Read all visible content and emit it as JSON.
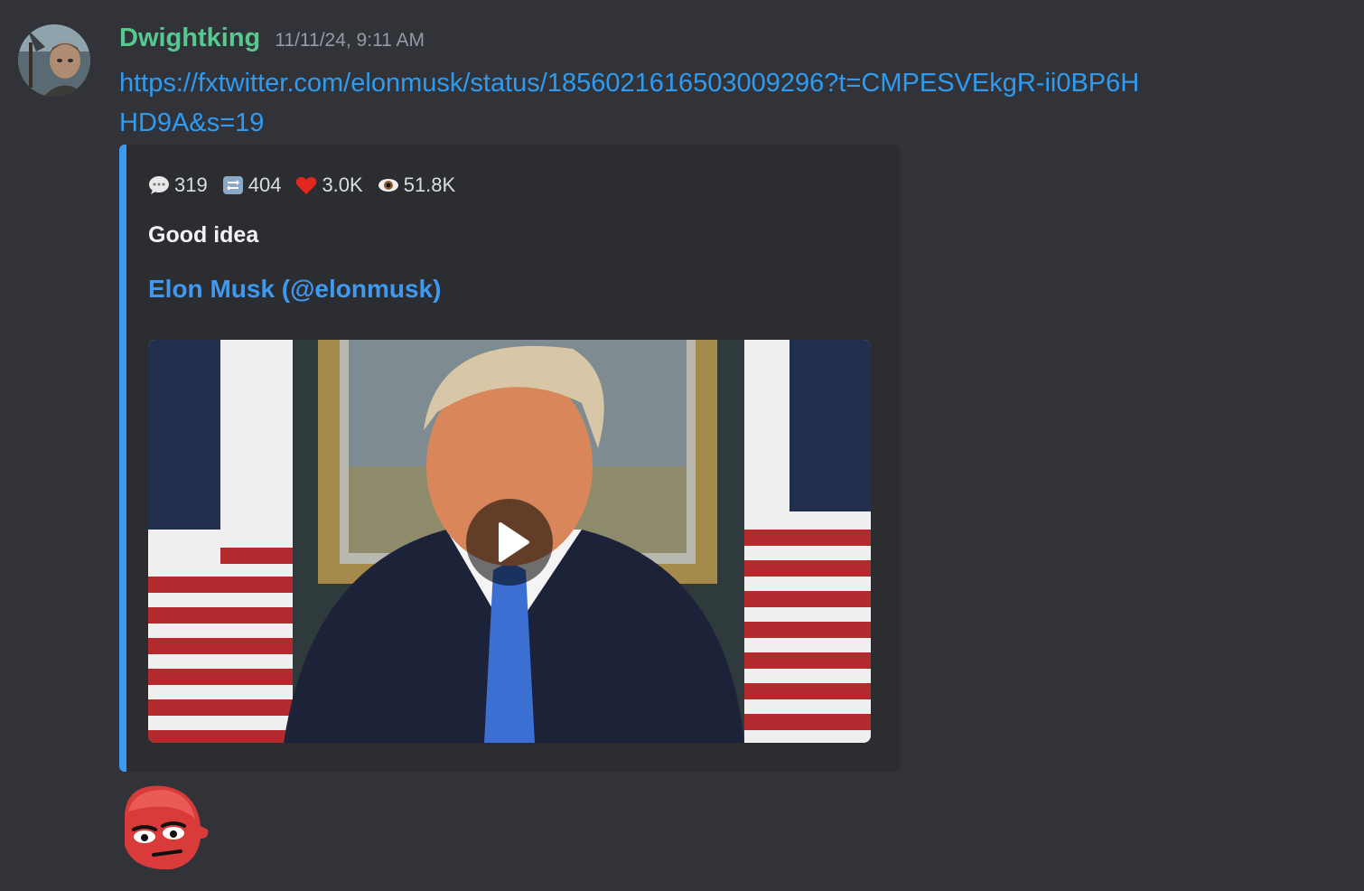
{
  "message": {
    "username": "Dwightking",
    "timestamp": "11/11/24, 9:11 AM",
    "link": "https://fxtwitter.com/elonmusk/status/1856021616503009296?t=CMPESVEkgR-ii0BP6HHD9A&s=19"
  },
  "embed": {
    "stats": {
      "replies": "319",
      "retweets": "404",
      "likes": "3.0K",
      "views": "51.8K"
    },
    "description": "Good idea",
    "author": "Elon Musk (@elonmusk)",
    "accent_color": "#3f99f0"
  },
  "colors": {
    "username": "#57c88f",
    "link": "#2f9bf0",
    "background": "#313338",
    "embed_background": "#2b2d31"
  },
  "icons": [
    "speech-bubble-icon",
    "retweet-icon",
    "heart-icon",
    "eye-icon",
    "play-icon"
  ]
}
